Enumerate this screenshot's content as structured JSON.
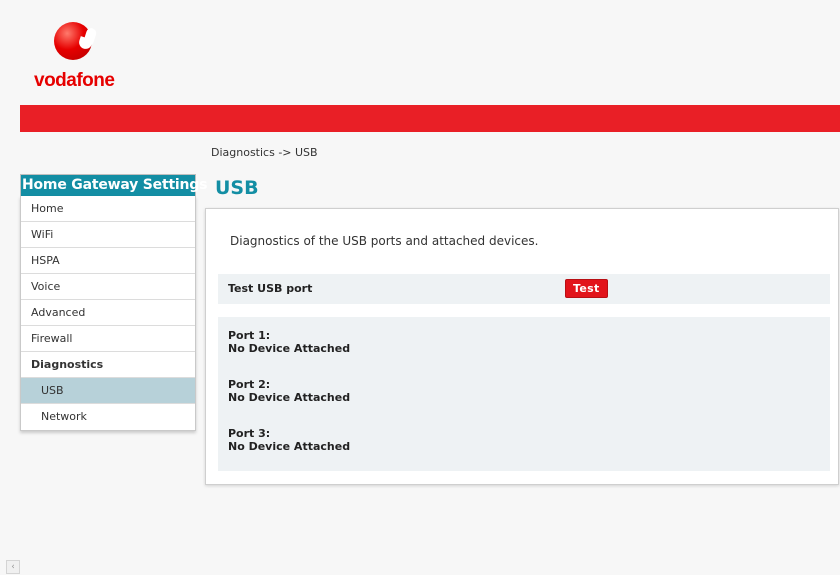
{
  "brand": {
    "name": "vodafone",
    "color": "#e60000"
  },
  "breadcrumb": "Diagnostics -> USB",
  "sidebar": {
    "title": "Home Gateway Settings",
    "items": [
      {
        "label": "Home"
      },
      {
        "label": "WiFi"
      },
      {
        "label": "HSPA"
      },
      {
        "label": "Voice"
      },
      {
        "label": "Advanced"
      },
      {
        "label": "Firewall"
      },
      {
        "label": "Diagnostics"
      },
      {
        "label": "USB"
      },
      {
        "label": "Network"
      }
    ],
    "active": "USB"
  },
  "main": {
    "title": "USB",
    "description": "Diagnostics of the USB ports and attached devices.",
    "test_label": "Test USB port",
    "test_button": "Test",
    "ports": [
      {
        "name": "Port 1:",
        "status": "No Device Attached"
      },
      {
        "name": "Port 2:",
        "status": "No Device Attached"
      },
      {
        "name": "Port 3:",
        "status": "No Device Attached"
      }
    ]
  },
  "colors": {
    "accent": "#138ea4",
    "red_bar": "#e91f26",
    "active_item": "#b7d1d9"
  },
  "icons": {
    "scroll_left": "chevron-left-icon"
  }
}
